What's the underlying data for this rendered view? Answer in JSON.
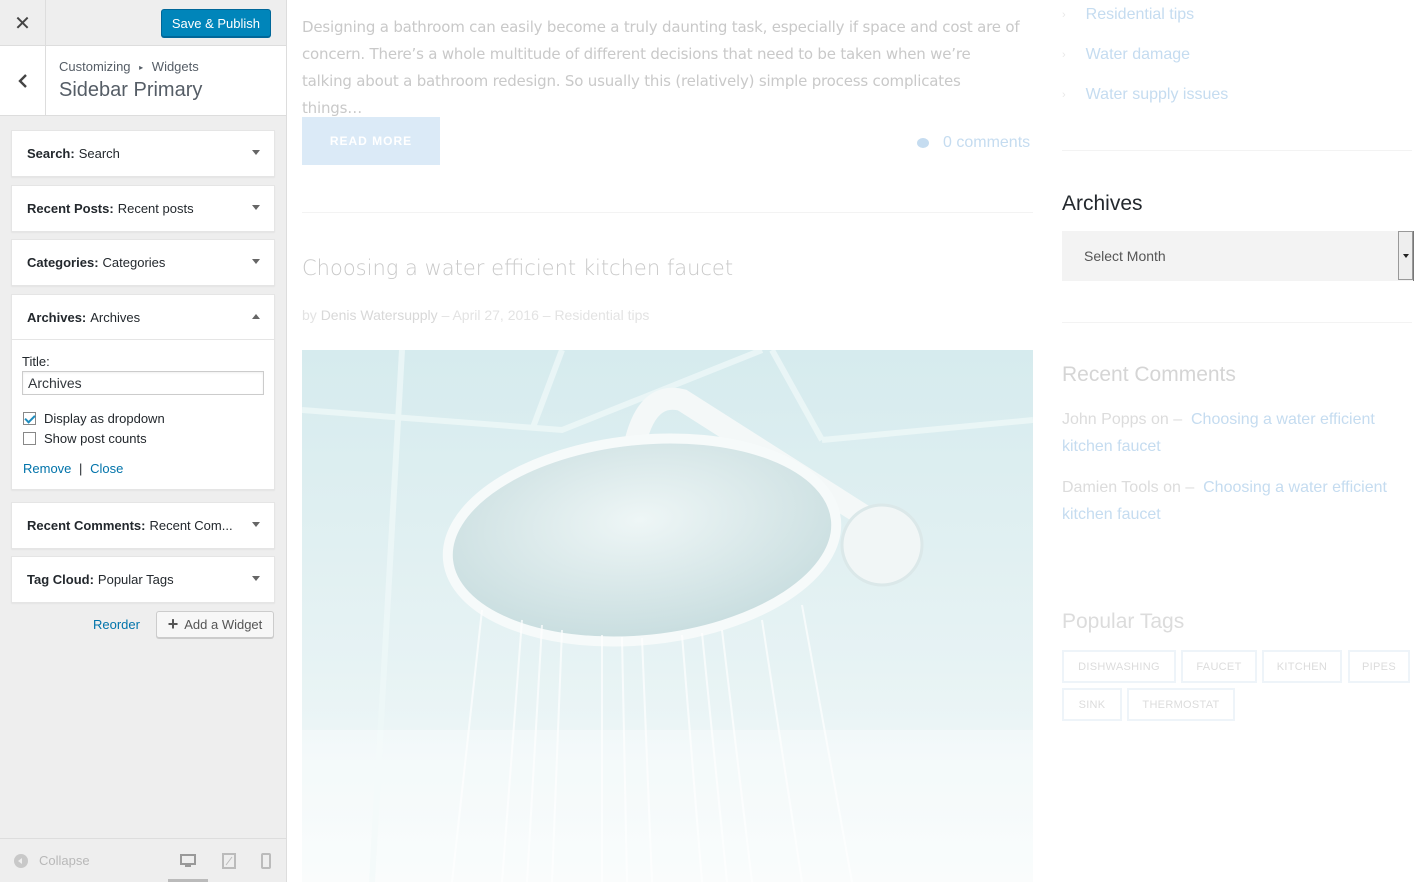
{
  "customizer": {
    "close_label": "✕",
    "save_label": "Save & Publish",
    "breadcrumb": [
      "Customizing",
      "Widgets"
    ],
    "breadcrumb_sep": "▸",
    "section_title": "Sidebar Primary",
    "widgets": [
      {
        "type": "Search:",
        "title": "Search",
        "expanded": false
      },
      {
        "type": "Recent Posts:",
        "title": "Recent posts",
        "expanded": false
      },
      {
        "type": "Categories:",
        "title": "Categories",
        "expanded": false
      },
      {
        "type": "Archives:",
        "title": "Archives",
        "expanded": true
      },
      {
        "type": "Recent Comments:",
        "title": "Recent Com...",
        "expanded": false
      },
      {
        "type": "Tag Cloud:",
        "title": "Popular Tags",
        "expanded": false
      }
    ],
    "archives_form": {
      "title_label": "Title:",
      "title_value": "Archives",
      "display_dropdown_label": "Display as dropdown",
      "display_dropdown_checked": true,
      "show_counts_label": "Show post counts",
      "show_counts_checked": false,
      "remove_label": "Remove",
      "close_label": "Close",
      "separator": "|"
    },
    "reorder_label": "Reorder",
    "add_widget_label": "Add a Widget",
    "collapse_label": "Collapse"
  },
  "preview": {
    "excerpt": "Designing a bathroom can easily become a truly daunting task, especially if space and cost are of concern. There’s a whole multitude of different decisions that need to be taken when we’re talking about a bathroom redesign. So usually this (relatively) simple process complicates things…",
    "read_more": "READ MORE",
    "comments": "0 comments",
    "post_title": "Choosing a water efficient kitchen faucet",
    "post_meta": {
      "by": "by",
      "author": "Denis Watersupply",
      "date": "– April 27, 2016 –",
      "category": "Residential tips"
    },
    "sidebar": {
      "categories": [
        "Residential tips",
        "Water damage",
        "Water supply issues"
      ],
      "archives_heading": "Archives",
      "archives_select": "Select Month",
      "recent_comments_heading": "Recent Comments",
      "recent_comments": [
        {
          "author": "John Popps",
          "on": "on –",
          "post": "Choosing a water efficient kitchen faucet"
        },
        {
          "author": "Damien Tools",
          "on": "on –",
          "post": "Choosing a water efficient kitchen faucet"
        }
      ],
      "popular_tags_heading": "Popular Tags",
      "tags": [
        "DISHWASHING",
        "FAUCET",
        "KITCHEN",
        "PIPES",
        "SINK",
        "THERMOSTAT"
      ]
    }
  },
  "colors": {
    "accent": "#0085ba",
    "link": "#0073aa"
  }
}
